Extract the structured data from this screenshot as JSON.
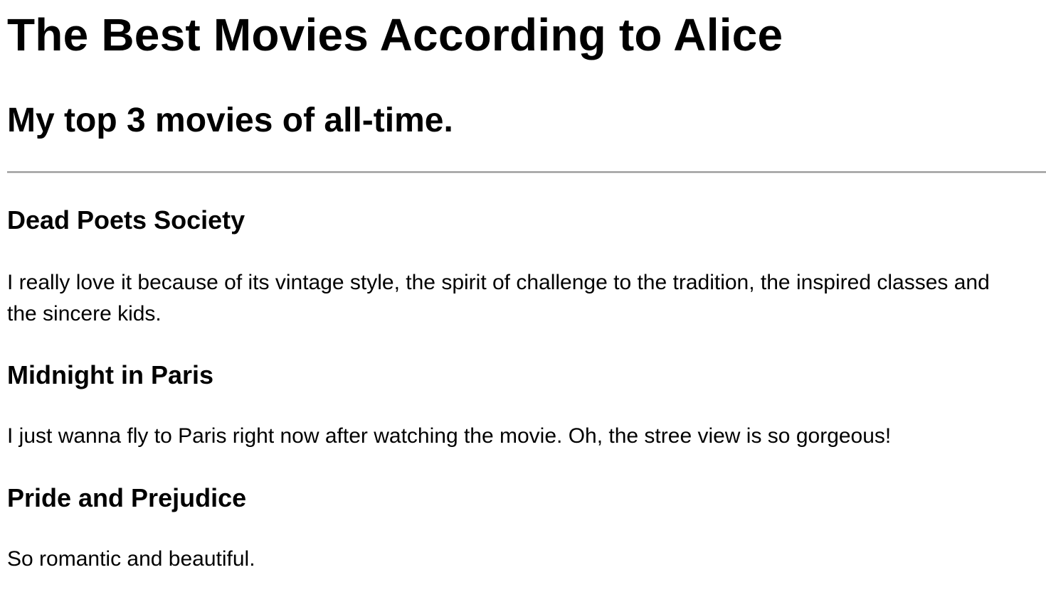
{
  "header": {
    "title": "The Best Movies According to Alice",
    "subtitle": "My top 3 movies of all-time."
  },
  "movies": [
    {
      "title": "Dead Poets Society",
      "description": "I really love it because of its vintage style, the spirit of challenge to the tradition, the inspired classes and the sincere kids."
    },
    {
      "title": "Midnight in Paris",
      "description": "I just wanna fly to Paris right now after watching the movie. Oh, the stree view is so gorgeous!"
    },
    {
      "title": "Pride and Prejudice",
      "description": "So romantic and beautiful."
    }
  ]
}
